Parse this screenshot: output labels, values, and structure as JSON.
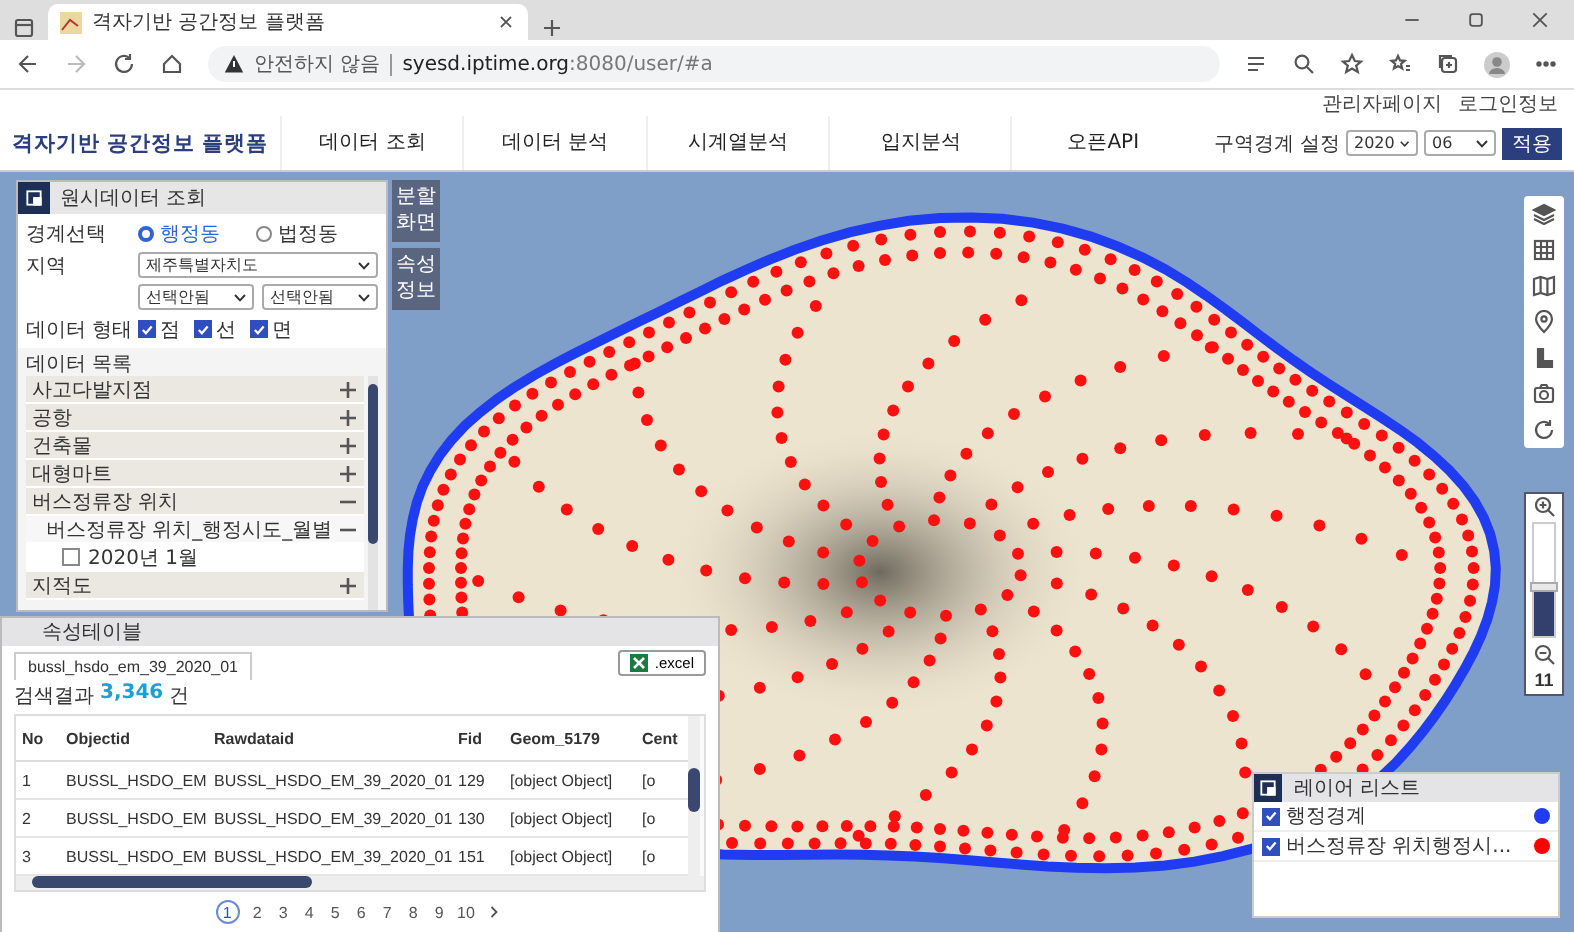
{
  "browser": {
    "tab_title": "격자기반 공간정보 플랫폼",
    "security_label": "안전하지 않음",
    "url_host": "syesd.iptime.org",
    "url_rest": ":8080/user/#a"
  },
  "utility_links": [
    "관리자페이지",
    "로그인정보"
  ],
  "header": {
    "logo": "격자기반 공간정보 플랫폼",
    "menu": [
      "데이터 조회",
      "데이터 분석",
      "시계열분석",
      "입지분석",
      "오픈API"
    ],
    "region_label": "구역경계 설정",
    "year": "2020",
    "month": "06",
    "apply": "적용"
  },
  "query_panel": {
    "title": "원시데이터 조회",
    "boundary_label": "경계선택",
    "boundary_options": [
      {
        "label": "행정동",
        "selected": true
      },
      {
        "label": "법정동",
        "selected": false
      }
    ],
    "region_label": "지역",
    "region": "제주특별자치도",
    "subregions": [
      "선택안됨",
      "선택안됨"
    ],
    "type_label": "데이터 형태",
    "types": [
      {
        "label": "점",
        "checked": true
      },
      {
        "label": "선",
        "checked": true
      },
      {
        "label": "면",
        "checked": true
      }
    ],
    "list_title": "데이터 목록",
    "items": [
      {
        "label": "사고다발지점",
        "expanded": false
      },
      {
        "label": "공항",
        "expanded": false
      },
      {
        "label": "건축물",
        "expanded": false
      },
      {
        "label": "대형마트",
        "expanded": false
      },
      {
        "label": "버스정류장 위치",
        "expanded": true,
        "children": [
          {
            "label": "버스정류장 위치_행정시도_월별",
            "expanded": true,
            "children": [
              {
                "label": "2020년 1월",
                "checked": false
              }
            ]
          }
        ]
      },
      {
        "label": "지적도",
        "expanded": false
      }
    ]
  },
  "side_buttons": [
    "분할 화면",
    "속성 정보"
  ],
  "attribute_table": {
    "title": "속성테이블",
    "tab": "bussl_hsdo_em_39_2020_01",
    "excel": ".excel",
    "result_label": "검색결과",
    "result_count": "3,346",
    "result_unit": "건",
    "columns": [
      "No",
      "Objectid",
      "Rawdataid",
      "Fid",
      "Geom_5179",
      "Cent"
    ],
    "rows": [
      [
        "1",
        "BUSSL_HSDO_EM",
        "BUSSL_HSDO_EM_39_2020_01",
        "129",
        "[object Object]",
        "[o"
      ],
      [
        "2",
        "BUSSL_HSDO_EM",
        "BUSSL_HSDO_EM_39_2020_01",
        "130",
        "[object Object]",
        "[o"
      ],
      [
        "3",
        "BUSSL_HSDO_EM",
        "BUSSL_HSDO_EM_39_2020_01",
        "151",
        "[object Object]",
        "[o"
      ]
    ],
    "pages": [
      {
        "label": "1",
        "selected": true
      },
      {
        "label": "2",
        "selected": false
      },
      {
        "label": "3",
        "selected": false
      },
      {
        "label": "4",
        "selected": false
      },
      {
        "label": "5",
        "selected": false
      },
      {
        "label": "6",
        "selected": false
      },
      {
        "label": "7",
        "selected": false
      },
      {
        "label": "8",
        "selected": false
      },
      {
        "label": "9",
        "selected": false
      },
      {
        "label": "10",
        "selected": false
      }
    ]
  },
  "zoom": {
    "level": 0.42,
    "value": "11"
  },
  "layer_list": {
    "title": "레이어 리스트",
    "layers": [
      {
        "label": "행정경계",
        "checked": true,
        "color": "#1f3cf0"
      },
      {
        "label": "버스정류장 위치행정시...",
        "checked": true,
        "color": "#ff0000"
      }
    ]
  }
}
